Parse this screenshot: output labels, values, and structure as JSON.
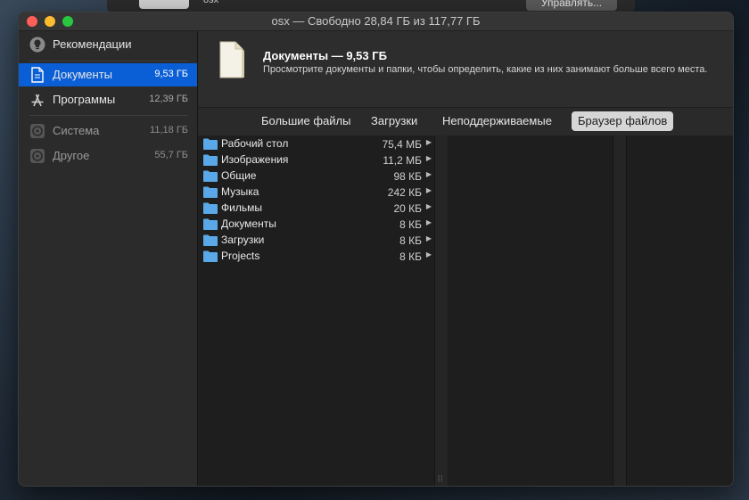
{
  "background_window": {
    "label": "osx",
    "button_label": "Управлять..."
  },
  "window": {
    "title": "osx — Свободно 28,84 ГБ из 117,77 ГБ"
  },
  "sidebar": {
    "items": [
      {
        "label": "Рекомендации",
        "size": "",
        "icon": "lightbulb-icon"
      },
      {
        "label": "Документы",
        "size": "9,53 ГБ",
        "icon": "document-icon",
        "active": true
      },
      {
        "label": "Программы",
        "size": "12,39 ГБ",
        "icon": "app-store-icon"
      },
      {
        "label": "Система",
        "size": "11,18 ГБ",
        "icon": "disk-icon"
      },
      {
        "label": "Другое",
        "size": "55,7 ГБ",
        "icon": "disk-icon"
      }
    ]
  },
  "header": {
    "title": "Документы — 9,53 ГБ",
    "description": "Просмотрите документы и папки, чтобы определить, какие из них занимают больше всего места."
  },
  "tabs": [
    {
      "label": "Большие файлы"
    },
    {
      "label": "Загрузки"
    },
    {
      "label": "Неподдерживаемые"
    },
    {
      "label": "Браузер файлов",
      "selected": true
    }
  ],
  "browser": {
    "rows": [
      {
        "name": "Рабочий стол",
        "size": "75,4 МБ",
        "icon": "desktop-folder-icon"
      },
      {
        "name": "Изображения",
        "size": "11,2 МБ",
        "icon": "pictures-folder-icon"
      },
      {
        "name": "Общие",
        "size": "98 КБ",
        "icon": "public-folder-icon"
      },
      {
        "name": "Музыка",
        "size": "242 КБ",
        "icon": "music-folder-icon"
      },
      {
        "name": "Фильмы",
        "size": "20 КБ",
        "icon": "movies-folder-icon"
      },
      {
        "name": "Документы",
        "size": "8 КБ",
        "icon": "documents-folder-icon"
      },
      {
        "name": "Загрузки",
        "size": "8 КБ",
        "icon": "downloads-folder-icon"
      },
      {
        "name": "Projects",
        "size": "8 КБ",
        "icon": "folder-icon"
      }
    ]
  },
  "colors": {
    "accent": "#0a5fd6",
    "folder": "#5aa8e6",
    "selected_tab": "#d6d6d6"
  }
}
